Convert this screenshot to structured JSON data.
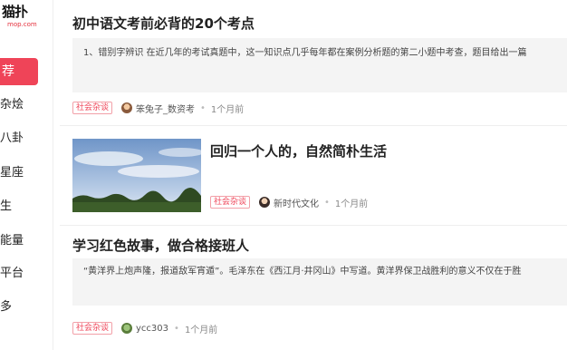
{
  "sidebar": {
    "logo": {
      "main": "猫扑",
      "sub": "mop.com"
    },
    "active_label": "荐",
    "items": [
      "杂烩",
      "八卦",
      "星座",
      "生",
      "能量",
      "平台",
      "多"
    ]
  },
  "feed": [
    {
      "title": "初中语文考前必背的20个考点",
      "excerpt": "1、错别字辨识 在近几年的考试真题中，这一知识点几乎每年都在案例分析题的第二小题中考查，题目给出一篇",
      "tag": "社会杂谈",
      "author": "笨兔子_数资考",
      "time": "1个月前"
    },
    {
      "title": "回归一个人的，自然简朴生活",
      "tag": "社会杂谈",
      "author": "新时代文化",
      "time": "1个月前"
    },
    {
      "title": "学习红色故事，做合格接班人",
      "excerpt": "“黄洋界上炮声隆，报道敌军宵遁”。毛泽东在《西江月·井冈山》中写道。黄洋界保卫战胜利的意义不仅在于胜",
      "tag": "社会杂谈",
      "author": "ycc303",
      "time": "1个月前"
    }
  ],
  "colors": {
    "accent": "#ef4458",
    "excerpt_bg": "#f4f4f4"
  }
}
